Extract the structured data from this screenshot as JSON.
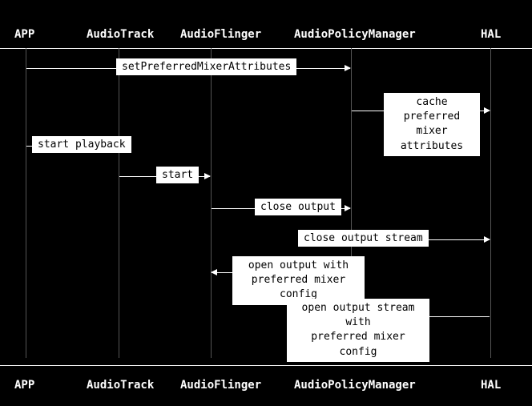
{
  "headers": {
    "app": "APP",
    "audiotrack": "AudioTrack",
    "audioflinger": "AudioFlinger",
    "audiopolicymanager": "AudioPolicyManager",
    "hal": "HAL"
  },
  "labels": {
    "set_preferred_mixer": "setPreferredMixerAttributes",
    "cache_preferred_mixer_line1": "cache preferred",
    "cache_preferred_mixer_line2": "mixer attributes",
    "start_playback": "start playback",
    "start": "start",
    "close_output": "close output",
    "close_output_stream": "close output stream",
    "open_output_preferred_line1": "open output with",
    "open_output_preferred_line2": "preferred mixer config",
    "open_output_stream_line1": "open output stream with",
    "open_output_stream_line2": "preferred mixer config"
  }
}
